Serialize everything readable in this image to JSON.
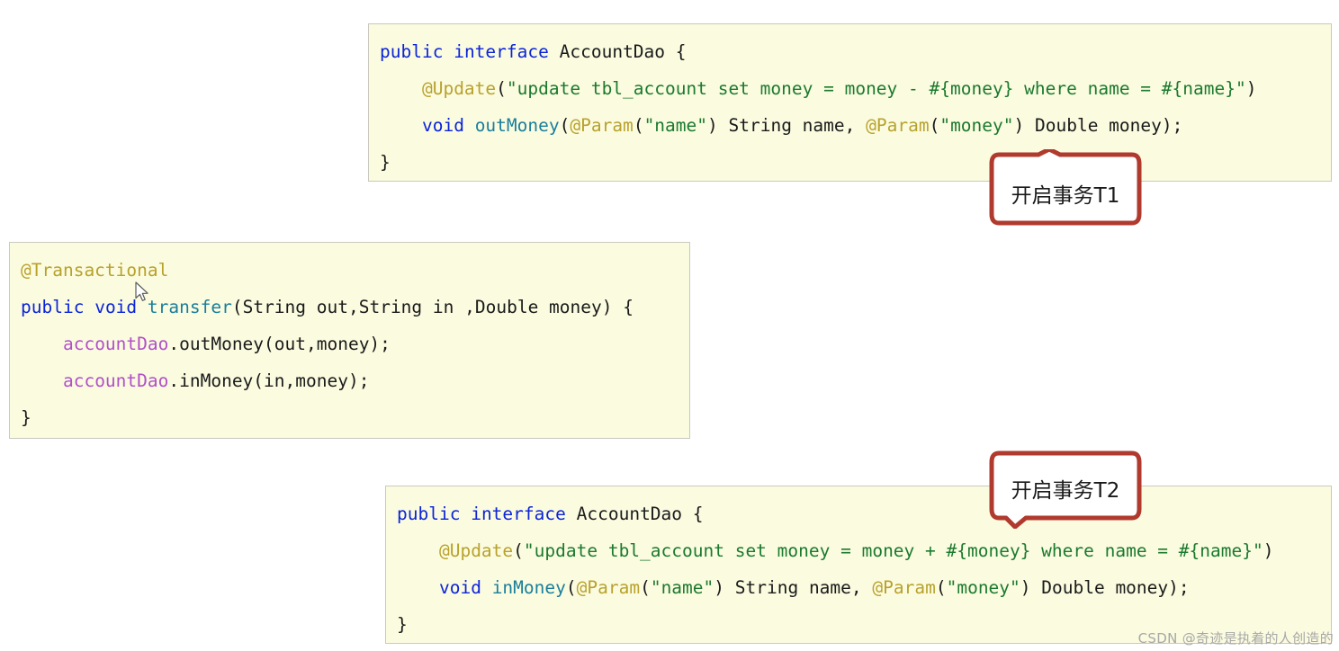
{
  "colors": {
    "code_background": "#fbfbe0",
    "code_border": "#c9c9c0",
    "keyword": "#0b24d8",
    "annotation": "#b8a22c",
    "string": "#1b7a2e",
    "method": "#1a7f9c",
    "field": "#b050c8",
    "plain": "#1a1a1a",
    "callout_border": "#b03a2e",
    "callout_fill": "#ffffff",
    "watermark": "#a8a8a8",
    "page_background": "#ffffff"
  },
  "code_blocks": {
    "top": {
      "lines": [
        [
          {
            "t": "public",
            "c": "kw"
          },
          {
            "t": " ",
            "c": "plain"
          },
          {
            "t": "interface",
            "c": "kw"
          },
          {
            "t": " ",
            "c": "plain"
          },
          {
            "t": "AccountDao",
            "c": "type"
          },
          {
            "t": " {",
            "c": "plain"
          }
        ],
        [
          {
            "t": "    ",
            "c": "plain"
          },
          {
            "t": "@Update",
            "c": "ann"
          },
          {
            "t": "(",
            "c": "plain"
          },
          {
            "t": "\"update tbl_account set money = money - #{money} where name = #{name}\"",
            "c": "str"
          },
          {
            "t": ")",
            "c": "plain"
          }
        ],
        [
          {
            "t": "    ",
            "c": "plain"
          },
          {
            "t": "void",
            "c": "kw"
          },
          {
            "t": " ",
            "c": "plain"
          },
          {
            "t": "outMoney",
            "c": "method"
          },
          {
            "t": "(",
            "c": "plain"
          },
          {
            "t": "@Param",
            "c": "ann"
          },
          {
            "t": "(",
            "c": "plain"
          },
          {
            "t": "\"name\"",
            "c": "str"
          },
          {
            "t": ") String name, ",
            "c": "plain"
          },
          {
            "t": "@Param",
            "c": "ann"
          },
          {
            "t": "(",
            "c": "plain"
          },
          {
            "t": "\"money\"",
            "c": "str"
          },
          {
            "t": ") Double money);",
            "c": "plain"
          }
        ],
        [
          {
            "t": "}",
            "c": "plain"
          }
        ]
      ]
    },
    "middle": {
      "lines": [
        [
          {
            "t": "@Transactional",
            "c": "ann"
          }
        ],
        [
          {
            "t": "public",
            "c": "kw"
          },
          {
            "t": " ",
            "c": "plain"
          },
          {
            "t": "void",
            "c": "kw"
          },
          {
            "t": " ",
            "c": "plain"
          },
          {
            "t": "transfer",
            "c": "method"
          },
          {
            "t": "(String out,String in ,Double money) {",
            "c": "plain"
          }
        ],
        [
          {
            "t": "    ",
            "c": "plain"
          },
          {
            "t": "accountDao",
            "c": "field"
          },
          {
            "t": ".outMoney(out,money);",
            "c": "plain"
          }
        ],
        [
          {
            "t": "    ",
            "c": "plain"
          },
          {
            "t": "accountDao",
            "c": "field"
          },
          {
            "t": ".inMoney(in,money);",
            "c": "plain"
          }
        ],
        [
          {
            "t": "}",
            "c": "plain"
          }
        ]
      ]
    },
    "bottom": {
      "lines": [
        [
          {
            "t": "public",
            "c": "kw"
          },
          {
            "t": " ",
            "c": "plain"
          },
          {
            "t": "interface",
            "c": "kw"
          },
          {
            "t": " ",
            "c": "plain"
          },
          {
            "t": "AccountDao",
            "c": "type"
          },
          {
            "t": " {",
            "c": "plain"
          }
        ],
        [
          {
            "t": "    ",
            "c": "plain"
          },
          {
            "t": "@Update",
            "c": "ann"
          },
          {
            "t": "(",
            "c": "plain"
          },
          {
            "t": "\"update tbl_account set money = money + #{money} where name = #{name}\"",
            "c": "str"
          },
          {
            "t": ")",
            "c": "plain"
          }
        ],
        [
          {
            "t": "    ",
            "c": "plain"
          },
          {
            "t": "void",
            "c": "kw"
          },
          {
            "t": " ",
            "c": "plain"
          },
          {
            "t": "inMoney",
            "c": "method"
          },
          {
            "t": "(",
            "c": "plain"
          },
          {
            "t": "@Param",
            "c": "ann"
          },
          {
            "t": "(",
            "c": "plain"
          },
          {
            "t": "\"name\"",
            "c": "str"
          },
          {
            "t": ") String name, ",
            "c": "plain"
          },
          {
            "t": "@Param",
            "c": "ann"
          },
          {
            "t": "(",
            "c": "plain"
          },
          {
            "t": "\"money\"",
            "c": "str"
          },
          {
            "t": ") Double money);",
            "c": "plain"
          }
        ],
        [
          {
            "t": "}",
            "c": "plain"
          }
        ]
      ]
    }
  },
  "callouts": {
    "t1": {
      "label": "开启事务T1",
      "pointer": "up"
    },
    "t2": {
      "label": "开启事务T2",
      "pointer": "down"
    }
  },
  "watermark": {
    "text": "CSDN @奇迹是执着的人创造的"
  }
}
